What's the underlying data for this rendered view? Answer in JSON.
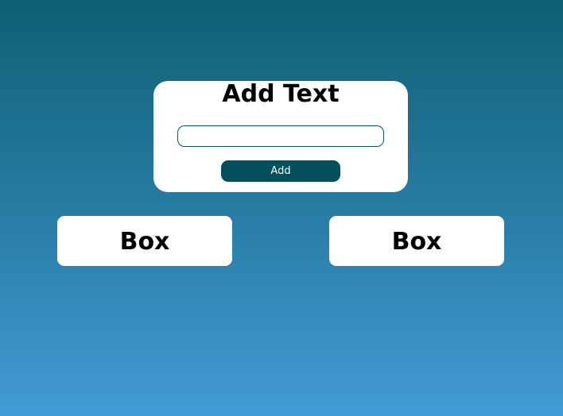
{
  "panel": {
    "title": "Add Text",
    "input_value": "",
    "button_label": "Add"
  },
  "boxes": [
    "Box",
    "Box"
  ]
}
